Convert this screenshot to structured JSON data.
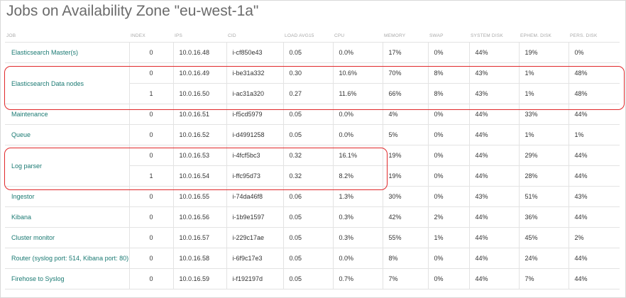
{
  "title": "Jobs on Availability Zone \"eu-west-1a\"",
  "columns": [
    "JOB",
    "INDEX",
    "IPS",
    "CID",
    "LOAD AVG15",
    "CPU",
    "MEMORY",
    "SWAP",
    "SYSTEM DISK",
    "EPHEM. DISK",
    "PERS. DISK"
  ],
  "jobs": [
    {
      "name": "Elasticsearch Master(s)",
      "instances": [
        {
          "index": "0",
          "ip": "10.0.16.48",
          "cid": "i-cf850e43",
          "load": "0.05",
          "cpu": "0.0%",
          "memory": "17%",
          "swap": "0%",
          "system_disk": "44%",
          "ephem_disk": "19%",
          "pers_disk": "0%"
        }
      ]
    },
    {
      "name": "Elasticsearch Data nodes",
      "highlighted": true,
      "instances": [
        {
          "index": "0",
          "ip": "10.0.16.49",
          "cid": "i-be31a332",
          "load": "0.30",
          "cpu": "10.6%",
          "memory": "70%",
          "swap": "8%",
          "system_disk": "43%",
          "ephem_disk": "1%",
          "pers_disk": "48%"
        },
        {
          "index": "1",
          "ip": "10.0.16.50",
          "cid": "i-ac31a320",
          "load": "0.27",
          "cpu": "11.6%",
          "memory": "66%",
          "swap": "8%",
          "system_disk": "43%",
          "ephem_disk": "1%",
          "pers_disk": "48%"
        }
      ]
    },
    {
      "name": "Maintenance",
      "instances": [
        {
          "index": "0",
          "ip": "10.0.16.51",
          "cid": "i-f5cd5979",
          "load": "0.05",
          "cpu": "0.0%",
          "memory": "4%",
          "swap": "0%",
          "system_disk": "44%",
          "ephem_disk": "33%",
          "pers_disk": "44%"
        }
      ]
    },
    {
      "name": "Queue",
      "instances": [
        {
          "index": "0",
          "ip": "10.0.16.52",
          "cid": "i-d4991258",
          "load": "0.05",
          "cpu": "0.0%",
          "memory": "5%",
          "swap": "0%",
          "system_disk": "44%",
          "ephem_disk": "1%",
          "pers_disk": "1%"
        }
      ]
    },
    {
      "name": "Log parser",
      "highlighted": true,
      "instances": [
        {
          "index": "0",
          "ip": "10.0.16.53",
          "cid": "i-4fcf5bc3",
          "load": "0.32",
          "cpu": "16.1%",
          "memory": "19%",
          "swap": "0%",
          "system_disk": "44%",
          "ephem_disk": "29%",
          "pers_disk": "44%"
        },
        {
          "index": "1",
          "ip": "10.0.16.54",
          "cid": "i-ffc95d73",
          "load": "0.32",
          "cpu": "8.2%",
          "memory": "19%",
          "swap": "0%",
          "system_disk": "44%",
          "ephem_disk": "28%",
          "pers_disk": "44%"
        }
      ]
    },
    {
      "name": "Ingestor",
      "instances": [
        {
          "index": "0",
          "ip": "10.0.16.55",
          "cid": "i-74da46f8",
          "load": "0.06",
          "cpu": "1.3%",
          "memory": "30%",
          "swap": "0%",
          "system_disk": "43%",
          "ephem_disk": "51%",
          "pers_disk": "43%"
        }
      ]
    },
    {
      "name": "Kibana",
      "instances": [
        {
          "index": "0",
          "ip": "10.0.16.56",
          "cid": "i-1b9e1597",
          "load": "0.05",
          "cpu": "0.3%",
          "memory": "42%",
          "swap": "2%",
          "system_disk": "44%",
          "ephem_disk": "36%",
          "pers_disk": "44%"
        }
      ]
    },
    {
      "name": "Cluster monitor",
      "instances": [
        {
          "index": "0",
          "ip": "10.0.16.57",
          "cid": "i-229c17ae",
          "load": "0.05",
          "cpu": "0.3%",
          "memory": "55%",
          "swap": "1%",
          "system_disk": "44%",
          "ephem_disk": "45%",
          "pers_disk": "2%"
        }
      ]
    },
    {
      "name": "Router (syslog port: 514, Kibana port: 80)",
      "instances": [
        {
          "index": "0",
          "ip": "10.0.16.58",
          "cid": "i-6f9c17e3",
          "load": "0.05",
          "cpu": "0.0%",
          "memory": "8%",
          "swap": "0%",
          "system_disk": "44%",
          "ephem_disk": "24%",
          "pers_disk": "44%"
        }
      ]
    },
    {
      "name": "Firehose to Syslog",
      "instances": [
        {
          "index": "0",
          "ip": "10.0.16.59",
          "cid": "i-f192197d",
          "load": "0.05",
          "cpu": "0.7%",
          "memory": "7%",
          "swap": "0%",
          "system_disk": "44%",
          "ephem_disk": "7%",
          "pers_disk": "44%"
        }
      ]
    }
  ],
  "colors": {
    "link": "#1b7a73",
    "highlight": "#e0282a",
    "title": "#6b6b6b"
  }
}
